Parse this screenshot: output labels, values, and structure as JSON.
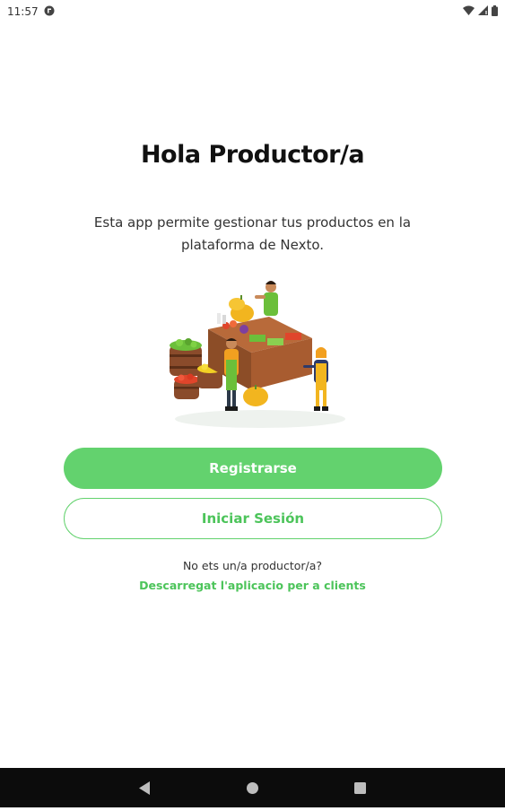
{
  "status_bar": {
    "time": "11:57",
    "icons": [
      "app-notification-icon",
      "wifi-icon",
      "signal-icon",
      "battery-icon"
    ]
  },
  "main": {
    "title": "Hola Productor/a",
    "description": "Esta app permite gestionar tus productos en la plataforma de Nexto.",
    "illustration": "market-stall-illustration",
    "register_button": "Registrarse",
    "login_button": "Iniciar Sesión",
    "question_text": "No ets un/a productor/a?",
    "download_link": "Descarregat l'aplicacio per a clients"
  },
  "nav_bar": {
    "icons": [
      "back-icon",
      "home-icon",
      "recents-icon"
    ]
  },
  "colors": {
    "accent": "#63d26e",
    "accent_text": "#4cc45a",
    "nav_bar": "#0c0c0c"
  }
}
